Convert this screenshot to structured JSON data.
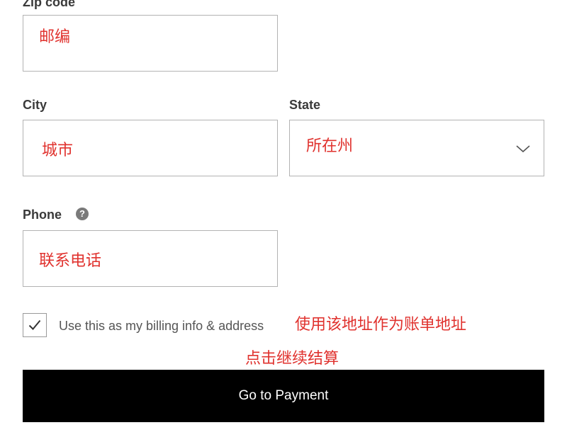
{
  "form": {
    "zip": {
      "label": "Zip code",
      "placeholder_annotation": "邮编"
    },
    "city": {
      "label": "City",
      "placeholder_annotation": "城市"
    },
    "state": {
      "label": "State",
      "placeholder_annotation": "所在州"
    },
    "phone": {
      "label": "Phone",
      "placeholder_annotation": "联系电话",
      "help_glyph": "?"
    },
    "billing": {
      "checked": true,
      "label": "Use this as my billing info & address",
      "annotation": "使用该地址作为账单地址"
    },
    "submit": {
      "annotation": "点击继续结算",
      "label": "Go to Payment"
    }
  },
  "colors": {
    "annotation": "#e0322e",
    "button_bg": "#000000",
    "button_text": "#ffffff",
    "border": "#b3b3b3"
  },
  "icons": [
    "help-circle-icon",
    "chevron-down-icon",
    "checkmark-icon"
  ]
}
